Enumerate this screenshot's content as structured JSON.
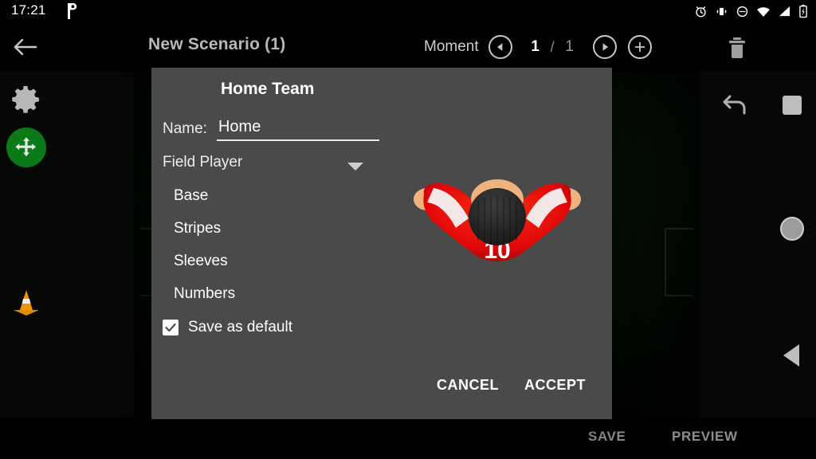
{
  "status_bar": {
    "time": "17:21",
    "app_icon": "pocketcasts-icon",
    "icons": [
      "alarm-icon",
      "vibrate-icon",
      "do-not-disturb-icon",
      "wifi-icon",
      "cellular-signal-icon",
      "battery-charging-icon"
    ]
  },
  "app_bar": {
    "back_icon": "back-arrow-icon",
    "title": "New Scenario (1)",
    "moment_label": "Moment",
    "prev_icon": "previous-moment-icon",
    "current_moment": "1",
    "separator": "/",
    "total_moments": "1",
    "next_icon": "next-moment-icon",
    "add_icon": "add-moment-icon",
    "delete_icon": "trash-icon"
  },
  "tools": {
    "gear": "gear-icon",
    "move": "move-tool-icon",
    "cone": "cone-icon",
    "undo": "undo-icon",
    "move_tool_color": "#0a7a18",
    "cone_color": "#f0960a"
  },
  "bottom_bar": {
    "save_label": "SAVE",
    "preview_label": "PREVIEW"
  },
  "nav_bar": {
    "recents": "recents-square-icon",
    "home": "home-circle-icon",
    "back": "back-triangle-icon"
  },
  "dialog": {
    "title": "Home Team",
    "name_label": "Name:",
    "name_value": "Home",
    "name_placeholder": "Name",
    "spinner_value": "Field Player",
    "spinner_arrow": "chevron-down-icon",
    "parts": [
      "Base",
      "Stripes",
      "Sleeves",
      "Numbers"
    ],
    "save_default_label": "Save as default",
    "save_default_checked": true,
    "cancel_label": "CANCEL",
    "accept_label": "ACCEPT",
    "background_color": "#4a4a4a"
  },
  "avatar": {
    "name": "field-player-preview",
    "jersey_color": "#e00808",
    "stripe_color": "#f2f2f2",
    "skin_color": "#f0b27f",
    "hair_color": "#2b2b2b",
    "number": "10",
    "number_color": "#ffffff"
  },
  "field": {
    "surface_color": "#0d2d0d",
    "line_color": "#d2e1d2"
  }
}
